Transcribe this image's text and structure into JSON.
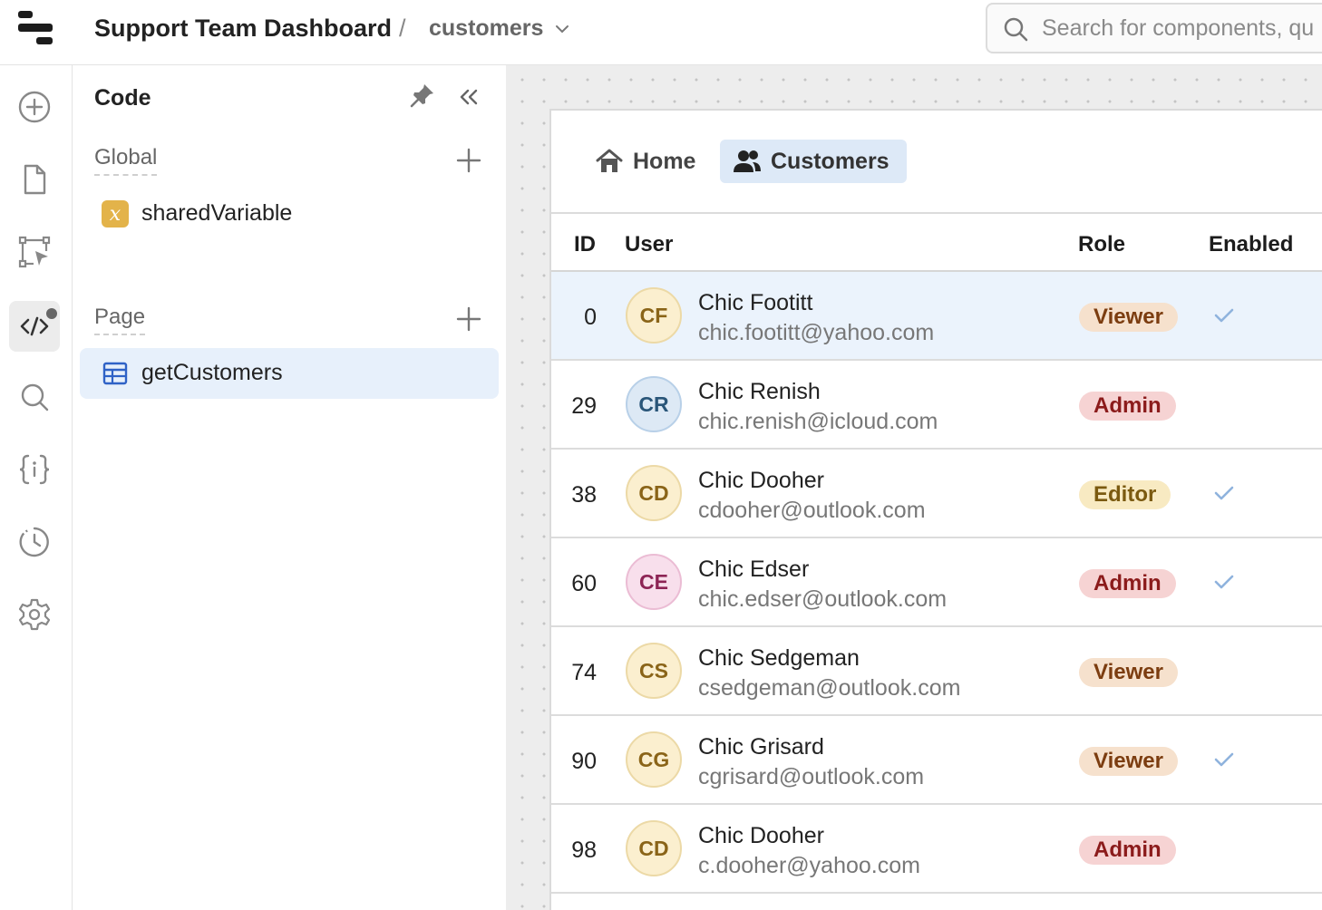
{
  "header": {
    "app_title": "Support Team Dashboard",
    "separator": "/",
    "page_name": "customers",
    "search_placeholder": "Search for components, qu"
  },
  "rail": {
    "icons": [
      "add-icon",
      "page-icon",
      "flow-icon",
      "code-icon",
      "search-icon",
      "variables-icon",
      "history-icon",
      "settings-icon"
    ],
    "active": "code-icon"
  },
  "code_panel": {
    "title": "Code",
    "global_label": "Global",
    "global_items": [
      {
        "label": "sharedVariable",
        "icon": "variable-icon"
      }
    ],
    "page_label": "Page",
    "page_items": [
      {
        "label": "getCustomers",
        "icon": "table-query-icon",
        "selected": true
      }
    ]
  },
  "app": {
    "nav": {
      "home_label": "Home",
      "customers_label": "Customers"
    },
    "table": {
      "columns": {
        "id": "ID",
        "user": "User",
        "role": "Role",
        "enabled": "Enabled"
      },
      "rows": [
        {
          "id": "0",
          "initials": "CF",
          "name": "Chic Footitt",
          "email": "chic.footitt@yahoo.com",
          "role": "Viewer",
          "enabled": true,
          "avatar_color": "yellow",
          "highlighted": true
        },
        {
          "id": "29",
          "initials": "CR",
          "name": "Chic Renish",
          "email": "chic.renish@icloud.com",
          "role": "Admin",
          "enabled": false,
          "avatar_color": "blue"
        },
        {
          "id": "38",
          "initials": "CD",
          "name": "Chic Dooher",
          "email": "cdooher@outlook.com",
          "role": "Editor",
          "enabled": true,
          "avatar_color": "yellow"
        },
        {
          "id": "60",
          "initials": "CE",
          "name": "Chic Edser",
          "email": "chic.edser@outlook.com",
          "role": "Admin",
          "enabled": true,
          "avatar_color": "pink"
        },
        {
          "id": "74",
          "initials": "CS",
          "name": "Chic Sedgeman",
          "email": "csedgeman@outlook.com",
          "role": "Viewer",
          "enabled": false,
          "avatar_color": "yellow"
        },
        {
          "id": "90",
          "initials": "CG",
          "name": "Chic Grisard",
          "email": "cgrisard@outlook.com",
          "role": "Viewer",
          "enabled": true,
          "avatar_color": "yellow"
        },
        {
          "id": "98",
          "initials": "CD",
          "name": "Chic Dooher",
          "email": "c.dooher@yahoo.com",
          "role": "Admin",
          "enabled": false,
          "avatar_color": "yellow"
        }
      ]
    }
  },
  "colors": {
    "selected_bg": "#e7f0fb",
    "row_highlight": "#ebf3fc",
    "check": "#8fb3dd",
    "viewer_badge": "#f6e1cd",
    "admin_badge": "#f6d3d3",
    "editor_badge": "#f8eac2"
  }
}
